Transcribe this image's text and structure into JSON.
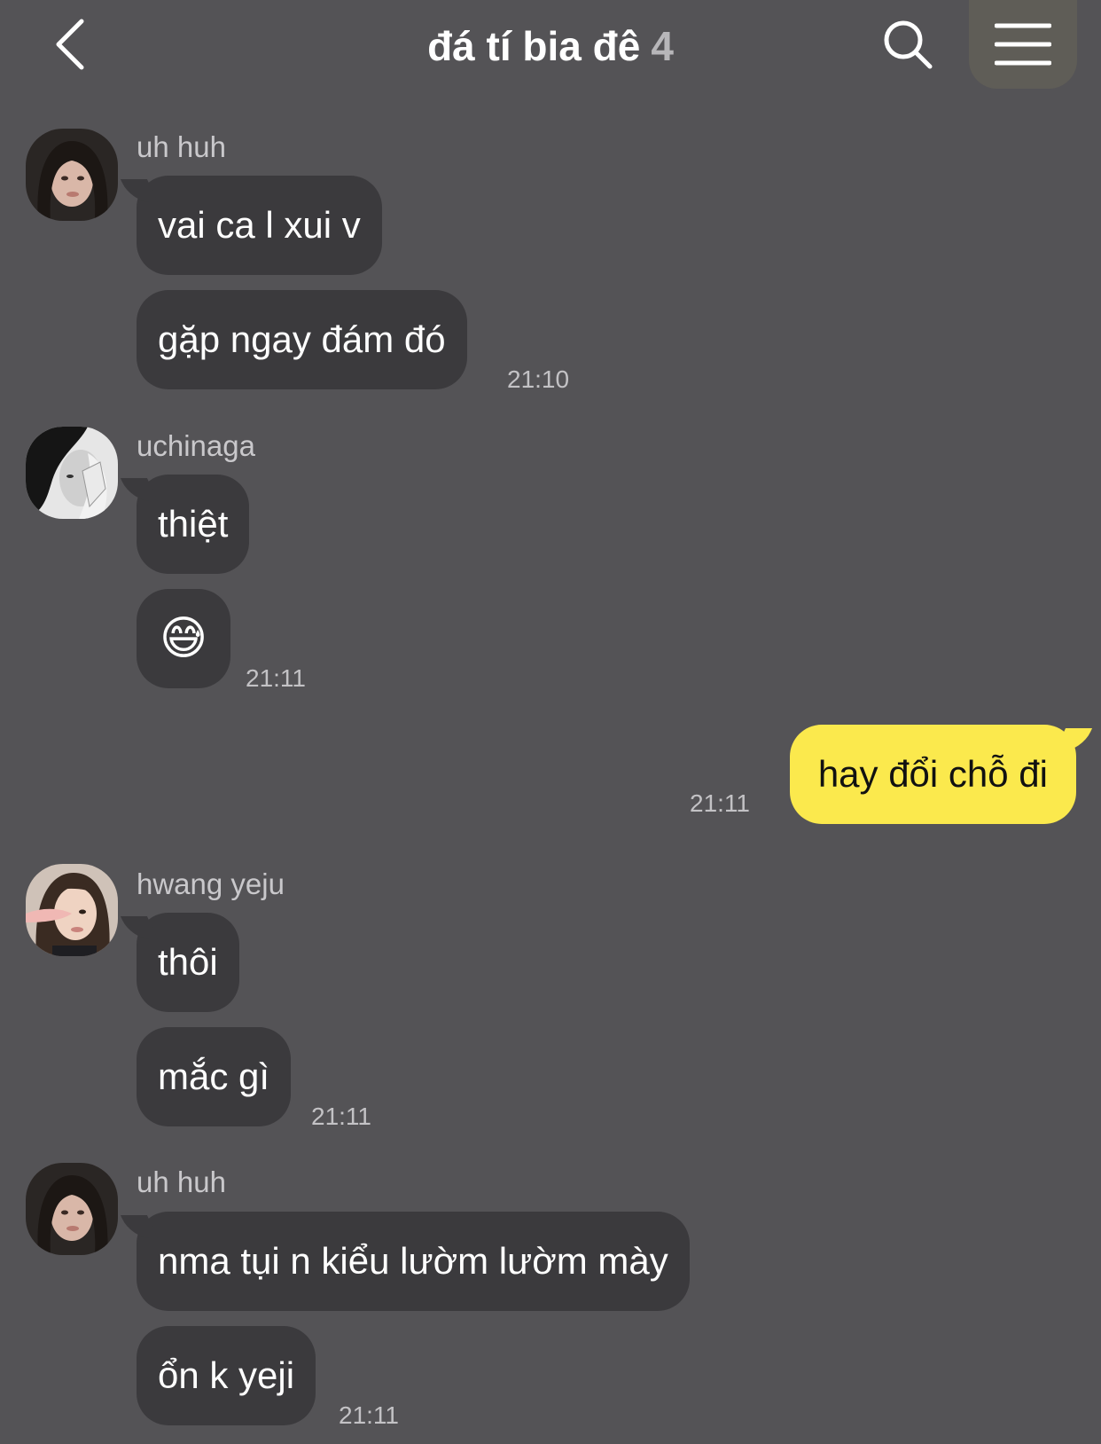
{
  "header": {
    "back_icon": "chevron-left-icon",
    "title": "đá tí bia đê",
    "member_count": "4",
    "search_icon": "search-icon",
    "menu_icon": "hamburger-menu-icon"
  },
  "messages": [
    {
      "sender": "uh huh",
      "avatar": "avatar-uh-huh",
      "bubbles": [
        "vai ca l xui v",
        "gặp ngay đám đó"
      ],
      "time": "21:10"
    },
    {
      "sender": "uchinaga",
      "avatar": "avatar-uchinaga",
      "bubbles": [
        "thiệt",
        "😅"
      ],
      "time": "21:11"
    },
    {
      "sender": "me",
      "bubbles": [
        "hay đổi chỗ đi"
      ],
      "time": "21:11"
    },
    {
      "sender": "hwang yeju",
      "avatar": "avatar-hwang-yeju",
      "bubbles": [
        "thôi",
        "mắc gì"
      ],
      "time": "21:11"
    },
    {
      "sender": "uh huh",
      "avatar": "avatar-uh-huh",
      "bubbles": [
        "nma tụi n kiểu lườm lườm mày",
        "ổn k yeji"
      ],
      "time": "21:11"
    }
  ],
  "colors": {
    "background": "#545356",
    "incoming_bubble": "#3b3a3d",
    "outgoing_bubble": "#fbe94d",
    "timestamp": "#c3c2c5"
  }
}
